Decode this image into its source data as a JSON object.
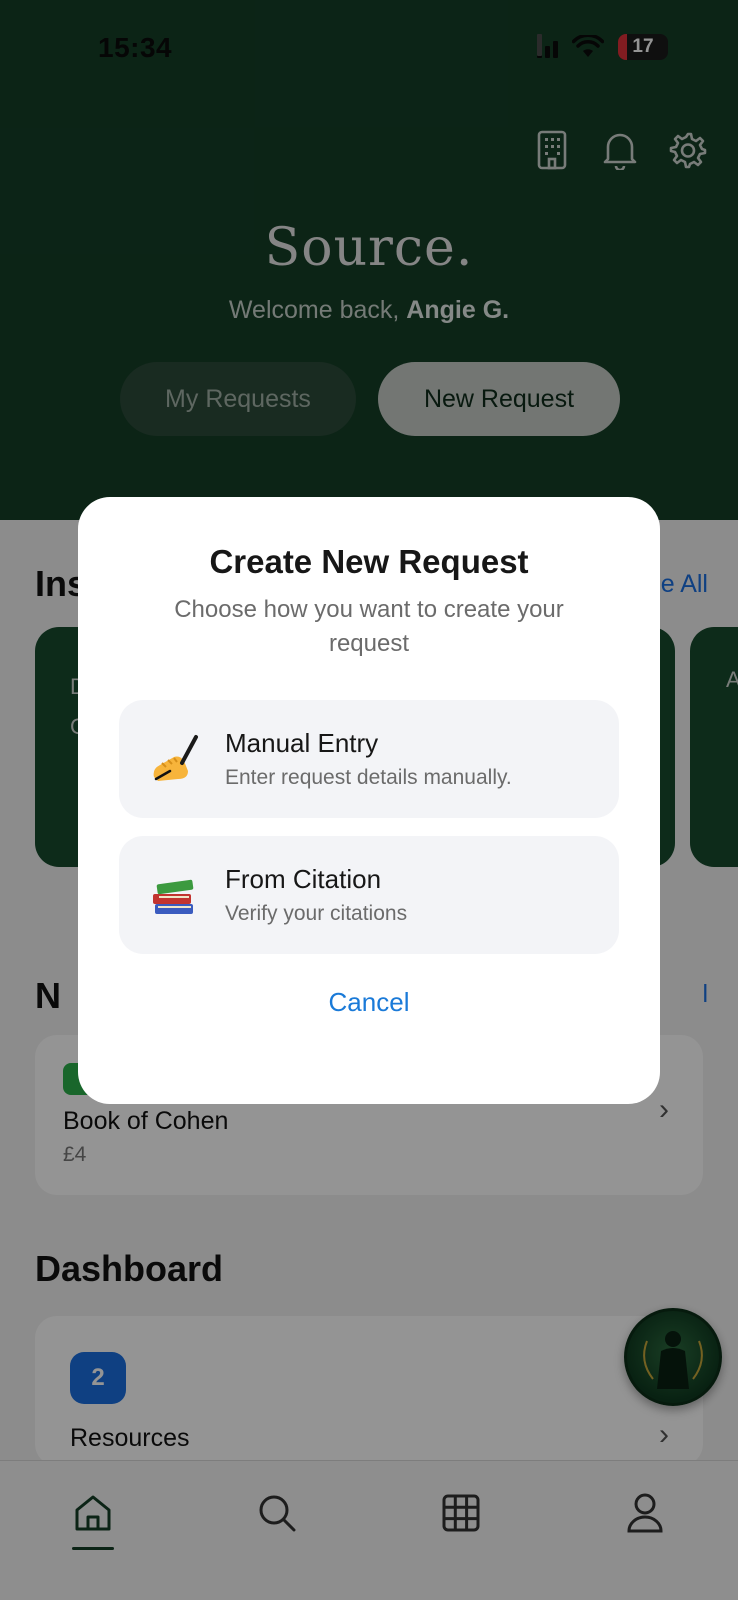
{
  "status_bar": {
    "time": "15:34",
    "battery": "17"
  },
  "header": {
    "icons": [
      "building-icon",
      "bell-icon",
      "gear-icon"
    ],
    "logo": "Source.",
    "welcome_prefix": "Welcome back, ",
    "welcome_name": "Angie G.",
    "my_requests_label": "My Requests",
    "new_request_label": "New Request"
  },
  "background": {
    "section1_title": "Ins",
    "section1_see_all": "e All",
    "section2_title": "N",
    "section2_see_all": "l",
    "card_left_letters": "D\nC",
    "card_right_letter": "A",
    "list_item": {
      "title": "Book of Cohen",
      "price": "£4"
    },
    "dashboard_title": "Dashboard",
    "dashboard_item": {
      "badge": "2",
      "label": "Resources"
    }
  },
  "modal": {
    "title": "Create New Request",
    "subtitle": "Choose how you want to create your request",
    "options": [
      {
        "icon": "writing-hand-icon",
        "title": "Manual Entry",
        "subtitle": "Enter request details manually."
      },
      {
        "icon": "books-icon",
        "title": "From Citation",
        "subtitle": "Verify your citations"
      }
    ],
    "cancel_label": "Cancel"
  },
  "tabbar": {
    "tabs": [
      "home-icon",
      "search-icon",
      "grid-icon",
      "profile-icon"
    ],
    "active": 0
  },
  "colors": {
    "brand_green": "#153e27",
    "accent_blue": "#1a7ad8"
  }
}
